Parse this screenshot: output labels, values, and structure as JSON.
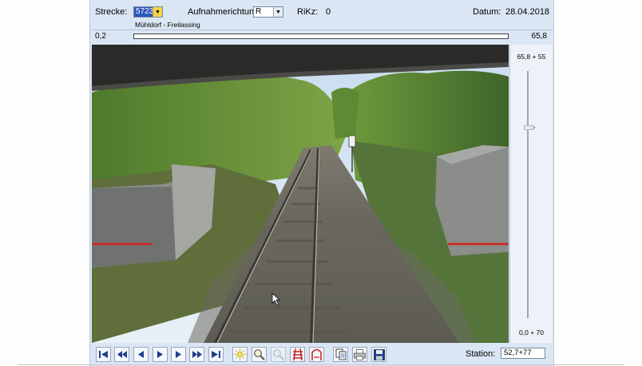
{
  "header": {
    "strecke_label": "Strecke:",
    "strecke_value": "5723",
    "richtung_label": "Aufnahmerichtung:",
    "richtung_value": "R",
    "rikz_label": "RiKz:",
    "rikz_value": "0",
    "datum_label": "Datum:",
    "datum_value": "28.04.2018",
    "route_name": "Mühldorf - Freilassing"
  },
  "position": {
    "start": "0,2",
    "end": "65,8",
    "progress": 0.0
  },
  "side_slider": {
    "top_label": "65,8 + 55",
    "bottom_label": "0,0 + 70",
    "level": 0.23
  },
  "toolbar": {
    "buttons": [
      "first-icon",
      "fast-back-icon",
      "step-back-icon",
      "play-icon",
      "step-forward-icon",
      "fast-forward-icon",
      "last-icon",
      "brightness-icon",
      "zoom-in-icon",
      "zoom-out-icon",
      "track-icon",
      "track-profile-icon",
      "copy-icon",
      "print-icon",
      "save-icon"
    ],
    "station_label": "Station:",
    "station_value": "52,7+77"
  },
  "colors": {
    "accent": "#2a58b8",
    "marker": "#d42020",
    "panel": "#dbe6f4"
  }
}
